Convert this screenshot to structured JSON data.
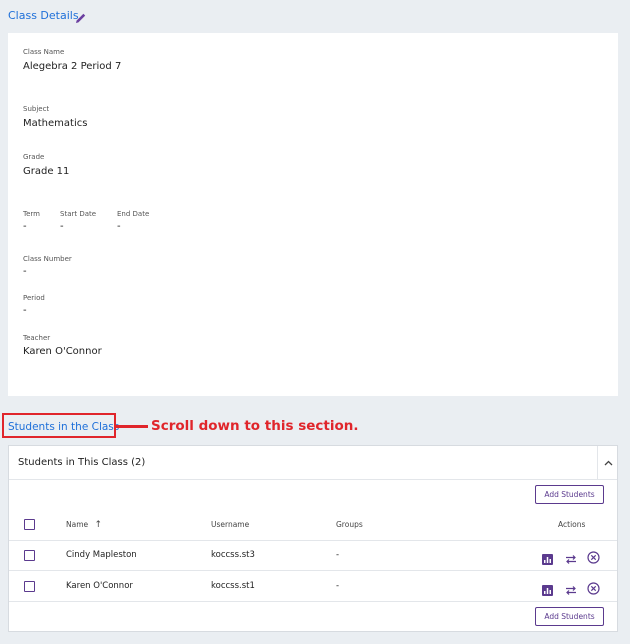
{
  "header": {
    "title": "Class Details"
  },
  "details": {
    "class_name": {
      "label": "Class Name",
      "value": "Alegebra 2 Period 7"
    },
    "subject": {
      "label": "Subject",
      "value": "Mathematics"
    },
    "grade": {
      "label": "Grade",
      "value": "Grade 11"
    },
    "term": {
      "label": "Term",
      "value": "-"
    },
    "start_date": {
      "label": "Start Date",
      "value": "-"
    },
    "end_date": {
      "label": "End Date",
      "value": "-"
    },
    "class_number": {
      "label": "Class Number",
      "value": "-"
    },
    "period": {
      "label": "Period",
      "value": "-"
    },
    "teacher": {
      "label": "Teacher",
      "value": "Karen O'Connor"
    }
  },
  "students_section": {
    "link_label": "Students in the Class",
    "annotation": "Scroll down to this section.",
    "panel_title": "Students in This Class (2)",
    "add_button_label": "Add Students",
    "columns": {
      "name": "Name",
      "username": "Username",
      "groups": "Groups",
      "actions": "Actions"
    },
    "rows": [
      {
        "name": "Cindy Mapleston",
        "username": "koccss.st3",
        "groups": "-"
      },
      {
        "name": "Karen O'Connor",
        "username": "koccss.st1",
        "groups": "-"
      }
    ]
  },
  "colors": {
    "accent": "#5b3a8e",
    "link": "#1e6fd9",
    "annotation": "#e0252b"
  }
}
